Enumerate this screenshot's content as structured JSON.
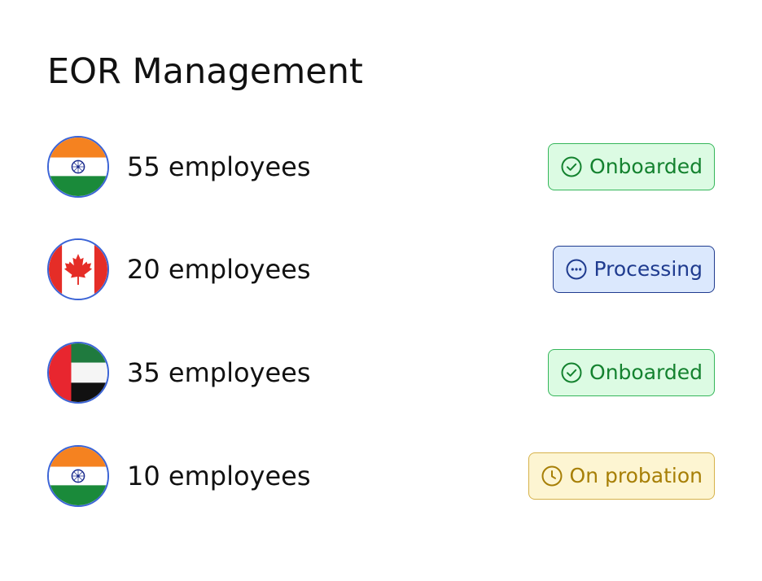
{
  "page": {
    "title": "EOR Management"
  },
  "rows": [
    {
      "flag": "india-flag",
      "count": "55 employees",
      "status": {
        "label": "Onboarded",
        "icon": "check-circle-icon",
        "tone": "green"
      }
    },
    {
      "flag": "canada-flag",
      "count": "20 employees",
      "status": {
        "label": "Processing",
        "icon": "more-horizontal-circle-icon",
        "tone": "blue"
      }
    },
    {
      "flag": "uae-flag",
      "count": "35 employees",
      "status": {
        "label": "Onboarded",
        "icon": "check-circle-icon",
        "tone": "green"
      }
    },
    {
      "flag": "india-flag",
      "count": "10 employees",
      "status": {
        "label": "On probation",
        "icon": "clock-icon",
        "tone": "yellow"
      }
    }
  ],
  "colors": {
    "green_bg": "#dcfbe3",
    "green_text": "#14822f",
    "blue_bg": "#dbe8fd",
    "blue_text": "#1f3b8f",
    "yellow_bg": "#fdf5d2",
    "yellow_text": "#a77f06",
    "flag_border": "#3b64d6"
  }
}
